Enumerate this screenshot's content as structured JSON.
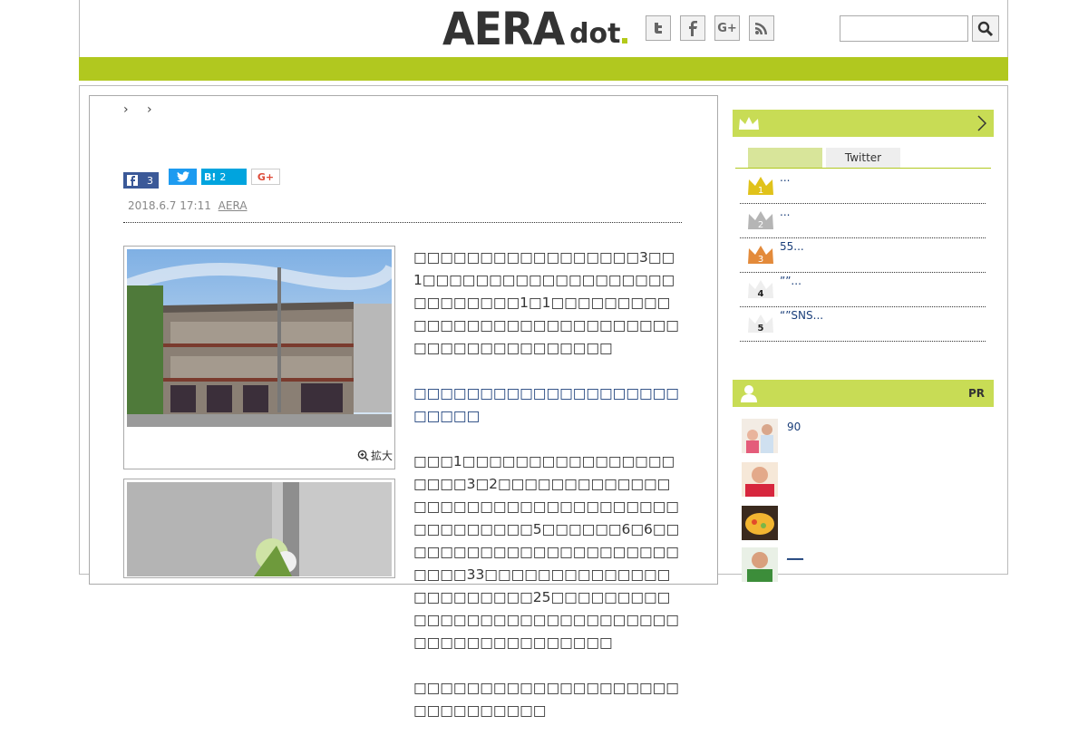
{
  "header": {
    "logo_main": "AERA",
    "logo_sub": "dot",
    "social": [
      {
        "name": "twitter-icon",
        "glyph": "t"
      },
      {
        "name": "facebook-icon",
        "glyph": "f"
      },
      {
        "name": "google-plus-icon",
        "glyph": "G+"
      },
      {
        "name": "rss-icon",
        "glyph": "◉"
      }
    ],
    "search_placeholder": "",
    "accent_color": "#b1c81f"
  },
  "article": {
    "breadcrumb": "› ›",
    "share": {
      "facebook_count": "3",
      "hatena_label": "B!",
      "hatena_count": "2",
      "google_label": "G+"
    },
    "date": "2018.6.7 17:11",
    "source": "AERA",
    "zoom_label": "拡大",
    "paragraphs": [
      "□□□□□□□□□□□□□□□□□3□□1□□□□□□□□□□□□□□□□□□□□□□□□□□□1□1□□□□□□□□□□□□□□□□□□□□□□□□□□□□□□□□□□□□□□□□□□□□",
      "□□□□□□□□□□□□□□□□□□□□□□□□□",
      "□□□1□□□□□□□□□□□□□□□□□□□□3□2□□□□□□□□□□□□□□□□□□□□□□□□□□□□□□□□□□□□□□□□□□5□□□□□□6□6□□□□□□□□□□□□□□□□□□□□□□□□□□33□□□□□□□□□□□□□□□□□□□□□□□25□□□□□□□□□□□□□□□□□□□□□□□□□□□□□□□□□□□□□□□□□□□□",
      "□□□□□□□□□□□□□□□□□□□□□□□□□□□□□□"
    ]
  },
  "ranking": {
    "tabs": [
      "",
      "Twitter"
    ],
    "items": [
      {
        "rank": "1",
        "text": "..."
      },
      {
        "rank": "2",
        "text": "..."
      },
      {
        "rank": "3",
        "text": "55..."
      },
      {
        "rank": "4",
        "text": "””..."
      },
      {
        "rank": "5",
        "text": "“”SNS..."
      }
    ]
  },
  "pr": {
    "label": "PR",
    "items": [
      {
        "text": "90"
      },
      {
        "text": ""
      },
      {
        "text": ""
      },
      {
        "text": "___"
      }
    ]
  }
}
